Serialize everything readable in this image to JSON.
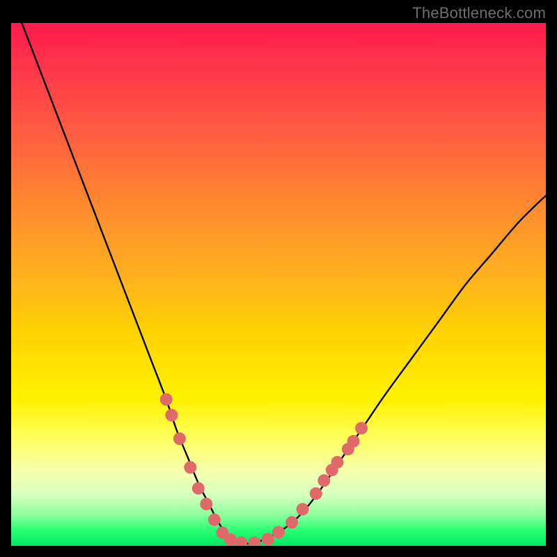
{
  "watermark": {
    "text": "TheBottleneck.com"
  },
  "colors": {
    "curve": "#000000",
    "marker_fill": "#e06a6a",
    "marker_stroke": "#b94d4d"
  },
  "chart_data": {
    "type": "line",
    "title": "",
    "xlabel": "",
    "ylabel": "",
    "xlim": [
      0,
      100
    ],
    "ylim": [
      0,
      100
    ],
    "series": [
      {
        "name": "bottleneck-curve",
        "x": [
          0,
          2,
          5,
          8,
          11,
          14,
          17,
          20,
          23,
          26,
          29,
          31,
          33,
          35,
          37,
          38.5,
          40,
          41.5,
          43,
          45,
          48,
          52,
          55,
          58,
          62,
          66,
          70,
          75,
          80,
          85,
          90,
          95,
          100
        ],
        "y": [
          105,
          100,
          92,
          84,
          76,
          68,
          60,
          52,
          44,
          36,
          28,
          22,
          17,
          12,
          8,
          5,
          2.5,
          1,
          0.5,
          0.5,
          1.5,
          4,
          7,
          11,
          17,
          23,
          29,
          36,
          43,
          50,
          56,
          62,
          67
        ]
      }
    ],
    "markers": [
      {
        "x": 29.0,
        "y": 28.0
      },
      {
        "x": 30.0,
        "y": 25.0
      },
      {
        "x": 31.5,
        "y": 20.5
      },
      {
        "x": 33.5,
        "y": 15.0
      },
      {
        "x": 35.0,
        "y": 11.0
      },
      {
        "x": 36.5,
        "y": 8.0
      },
      {
        "x": 38.0,
        "y": 5.0
      },
      {
        "x": 39.5,
        "y": 2.5
      },
      {
        "x": 41.0,
        "y": 1.2
      },
      {
        "x": 43.0,
        "y": 0.6
      },
      {
        "x": 45.5,
        "y": 0.6
      },
      {
        "x": 48.0,
        "y": 1.3
      },
      {
        "x": 50.0,
        "y": 2.6
      },
      {
        "x": 52.5,
        "y": 4.5
      },
      {
        "x": 54.5,
        "y": 7.0
      },
      {
        "x": 57.0,
        "y": 10.0
      },
      {
        "x": 58.5,
        "y": 12.5
      },
      {
        "x": 60.0,
        "y": 14.5
      },
      {
        "x": 61.0,
        "y": 16.0
      },
      {
        "x": 63.0,
        "y": 18.5
      },
      {
        "x": 64.0,
        "y": 20.0
      },
      {
        "x": 65.5,
        "y": 22.5
      }
    ],
    "marker_radius_px": 9
  }
}
